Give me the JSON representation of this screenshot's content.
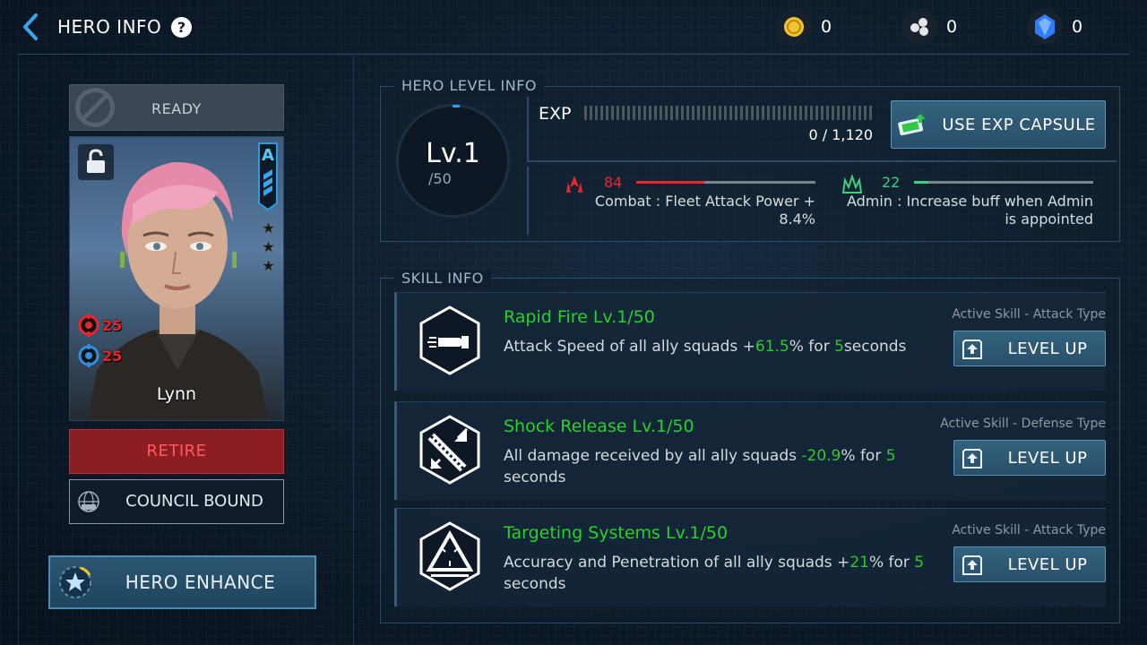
{
  "header": {
    "title": "HERO INFO",
    "help": "?",
    "resources": [
      {
        "icon": "gold-coin-icon",
        "value": "0",
        "color": "#f2c230"
      },
      {
        "icon": "material-icon",
        "value": "0",
        "color": "#e6e6e6"
      },
      {
        "icon": "crystal-icon",
        "value": "0",
        "color": "#2f7cff"
      }
    ]
  },
  "hero": {
    "status": "READY",
    "name": "Lynn",
    "rank": "A",
    "stars": "★★★",
    "attack": "25",
    "defense": "25",
    "retire_label": "RETIRE",
    "council_label": "COUNCIL BOUND",
    "enhance_label": "HERO ENHANCE"
  },
  "level_info": {
    "section_label": "HERO LEVEL INFO",
    "level": "Lv.1",
    "max": "/50",
    "exp_label": "EXP",
    "exp_value": "0 / 1,120",
    "exp_fraction": 0,
    "capsule_label": "USE EXP CAPSULE",
    "combat": {
      "value": "84",
      "fraction": 0.38,
      "color": "#e8262c",
      "line1": "Combat : Fleet Attack Power +",
      "line2": "8.4%"
    },
    "admin": {
      "value": "22",
      "fraction": 0.08,
      "color": "#3ad17a",
      "line1": "Admin : Increase buff when Admin",
      "line2": "is appointed"
    }
  },
  "skills": {
    "section_label": "SKILL INFO",
    "level_up_label": "LEVEL UP",
    "items": [
      {
        "name": "Rapid Fire Lv.1/50",
        "type": "Active Skill - Attack Type",
        "d1": "Attack Speed of all ally squads +",
        "h1": "61.5",
        "d2": "% for ",
        "h2": "5",
        "d3": "seconds"
      },
      {
        "name": "Shock Release Lv.1/50",
        "type": "Active Skill - Defense Type",
        "d1": "All damage received by all ally squads ",
        "h1": "-20.9",
        "d2": "% for ",
        "h2": "5",
        "d3": " seconds"
      },
      {
        "name": "Targeting Systems Lv.1/50",
        "type": "Active Skill - Attack Type",
        "d1": "Accuracy and Penetration of all ally squads +",
        "h1": "21",
        "d2": "% for ",
        "h2": "5",
        "d3": " seconds"
      }
    ]
  }
}
